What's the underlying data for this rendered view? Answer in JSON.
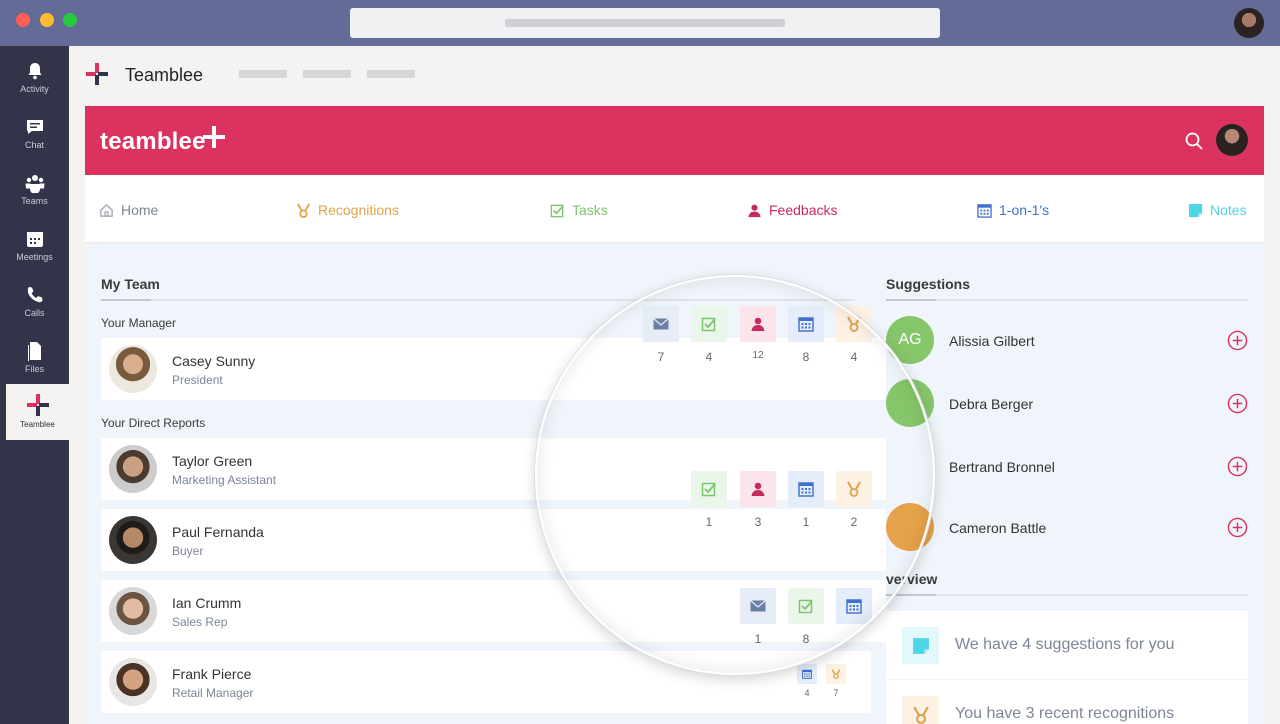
{
  "window": {
    "traffic_lights": [
      "close",
      "minimize",
      "maximize"
    ]
  },
  "rail": {
    "items": [
      {
        "label": "Activity",
        "icon": "bell-icon"
      },
      {
        "label": "Chat",
        "icon": "chat-icon"
      },
      {
        "label": "Teams",
        "icon": "teams-icon"
      },
      {
        "label": "Meetings",
        "icon": "calendar-icon"
      },
      {
        "label": "Calls",
        "icon": "phone-icon"
      },
      {
        "label": "Files",
        "icon": "file-icon"
      },
      {
        "label": "Teamblee",
        "icon": "teamblee-icon"
      }
    ]
  },
  "app": {
    "name": "Teamblee"
  },
  "banner": {
    "brand": "teamblee"
  },
  "nav": {
    "home": "Home",
    "recognitions": "Recognitions",
    "tasks": "Tasks",
    "feedbacks": "Feedbacks",
    "one_on_ones": "1-on-1's",
    "notes": "Notes"
  },
  "colors": {
    "brand": "#db325f",
    "recognitions": "#e0a24a",
    "tasks": "#7cc56f",
    "feedbacks": "#c62b5a",
    "one_on_ones": "#3f6fd0",
    "notes": "#4fd5e8"
  },
  "team": {
    "title": "My Team",
    "manager_label": "Your Manager",
    "reports_label": "Your Direct Reports",
    "manager": {
      "name": "Casey Sunny",
      "role": "President",
      "stats": {
        "mail": "7",
        "tasks": "4",
        "feedbacks": "12",
        "meetings": "8",
        "recognitions": "4"
      }
    },
    "reports": [
      {
        "name": "Taylor Green",
        "role": "Marketing Assistant",
        "stats": {
          "tasks": "1",
          "feedbacks": "3",
          "meetings": "1",
          "recognitions": "2"
        }
      },
      {
        "name": "Paul Fernanda",
        "role": "Buyer"
      },
      {
        "name": "Ian Crumm",
        "role": "Sales Rep",
        "stats": {
          "mail": "1",
          "tasks": "8"
        }
      },
      {
        "name": "Frank Pierce",
        "role": "Retail Manager",
        "stats": {
          "meetings": "4",
          "recognitions": "7"
        }
      }
    ]
  },
  "suggestions": {
    "title": "Suggestions",
    "items": [
      {
        "initials": "AG",
        "name": "Alissia Gilbert",
        "color": "#86c66a"
      },
      {
        "initials": "",
        "name": "Debra Berger",
        "color": "#86c66a"
      },
      {
        "initials": "",
        "name": "Bertrand Bronnel",
        "color": "#c98a4a"
      },
      {
        "initials": "",
        "name": "Cameron Battle",
        "color": "#e6a24a"
      }
    ]
  },
  "overview": {
    "title": "verview",
    "items": [
      {
        "text": "We have 4 suggestions for you",
        "icon": "note-icon"
      },
      {
        "text": "You have 3 recent recognitions",
        "icon": "medal-icon"
      }
    ]
  }
}
